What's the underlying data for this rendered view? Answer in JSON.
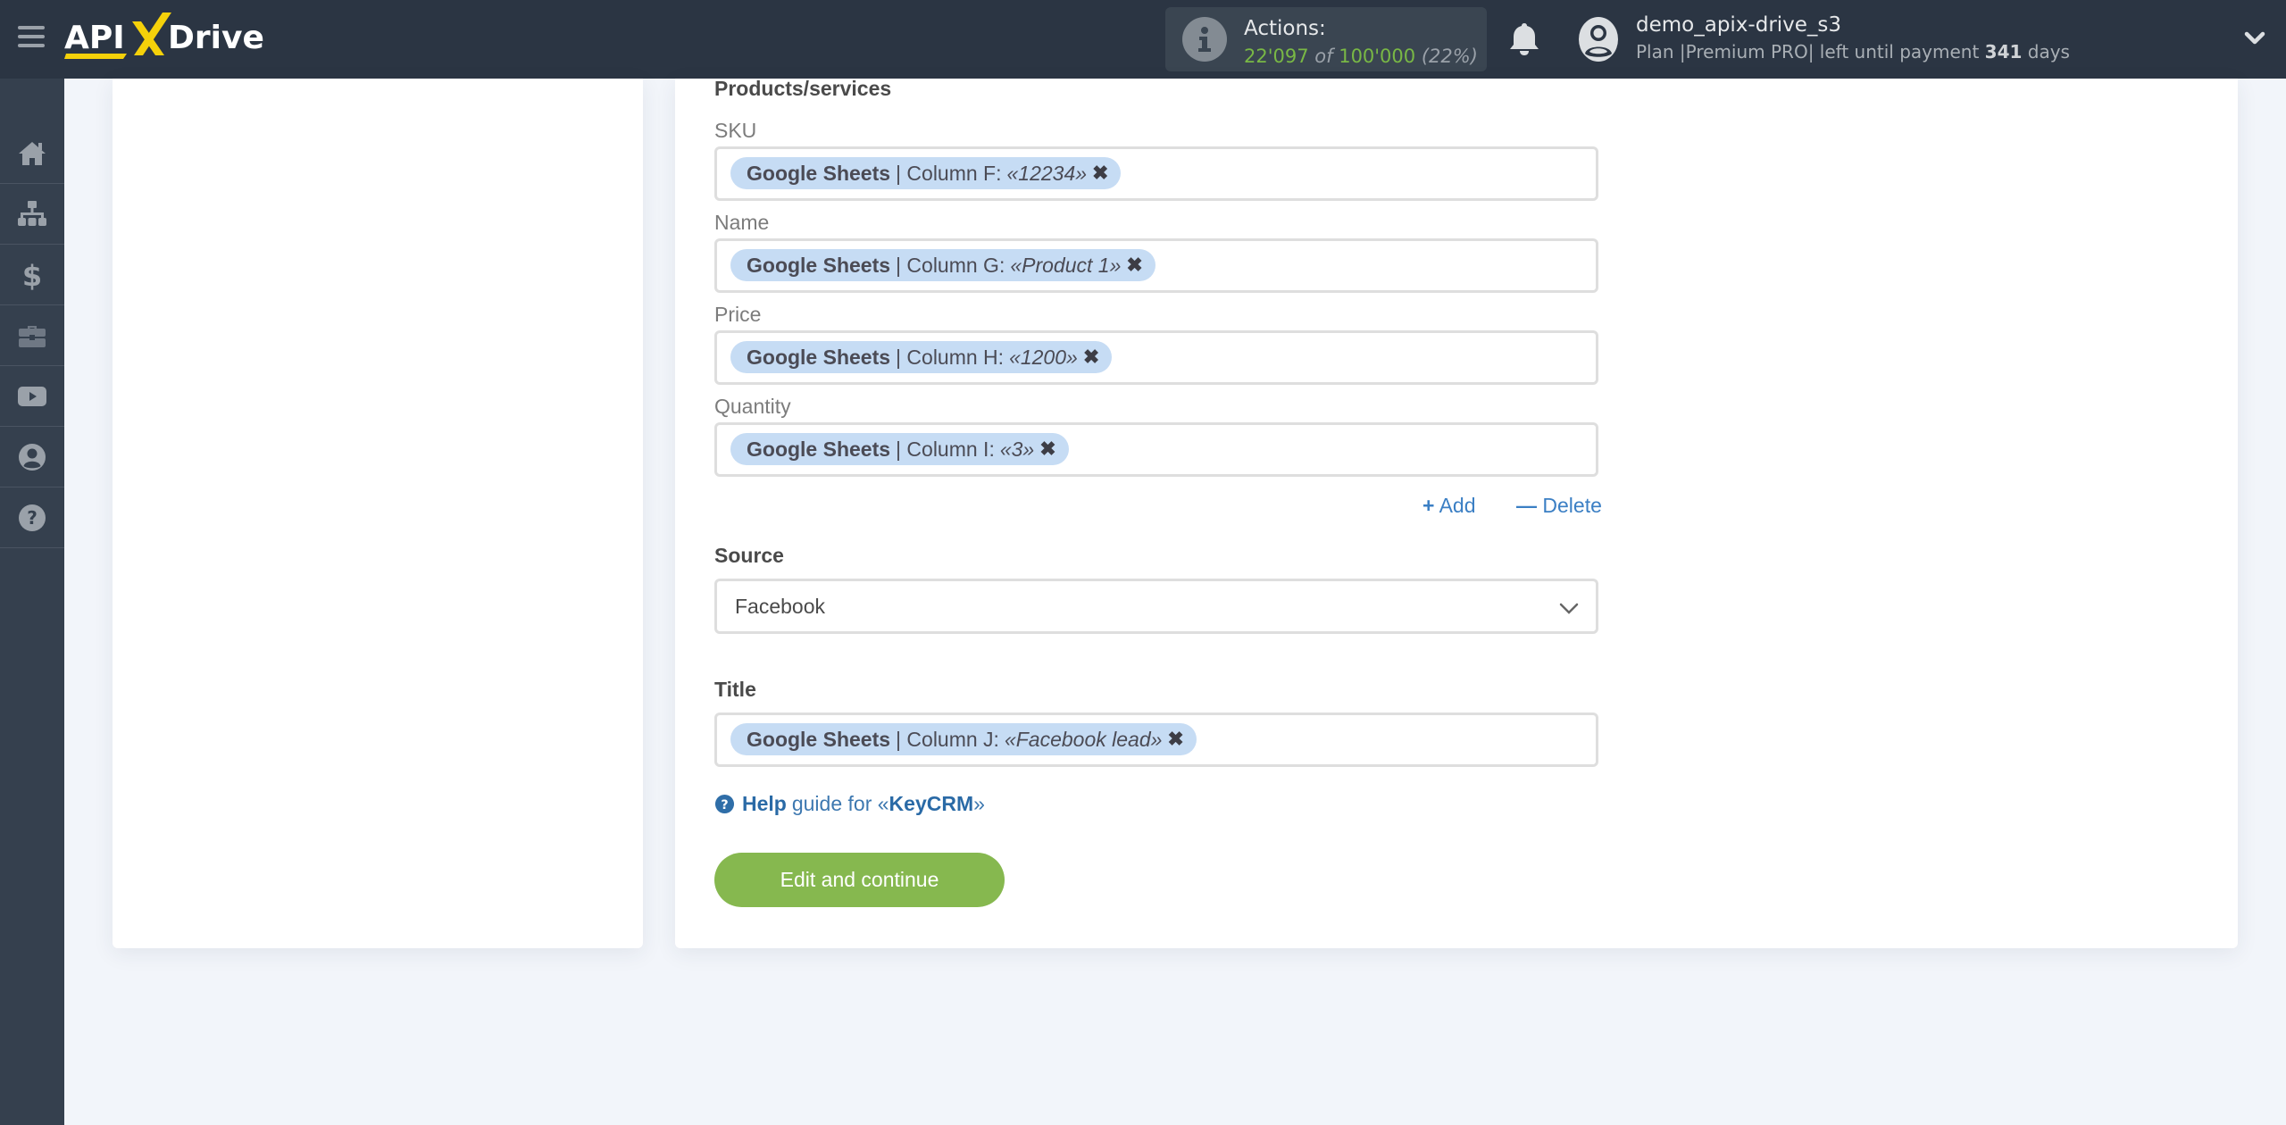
{
  "header": {
    "logo": {
      "part1": "API",
      "part2": "X",
      "part3": "Drive"
    },
    "actions": {
      "label": "Actions:",
      "used": "22'097",
      "of": "of",
      "total": "100'000",
      "percent": "(22%)",
      "usage_fraction": 0.22
    },
    "user": {
      "name": "demo_apix-drive_s3",
      "plan_prefix": "Plan |Premium PRO| left until payment",
      "days_left": "341",
      "days_suffix": "days"
    }
  },
  "sidebar": {
    "items": [
      {
        "name": "home",
        "icon": "home-icon"
      },
      {
        "name": "connections",
        "icon": "sitemap-icon"
      },
      {
        "name": "billing",
        "icon": "dollar-icon"
      },
      {
        "name": "services",
        "icon": "briefcase-icon"
      },
      {
        "name": "video",
        "icon": "youtube-icon"
      },
      {
        "name": "account",
        "icon": "user-circle-icon"
      },
      {
        "name": "help",
        "icon": "question-circle-icon"
      }
    ]
  },
  "form": {
    "section_title": "Products/services",
    "fields": [
      {
        "label": "SKU",
        "chip": {
          "source": "Google Sheets",
          "column": "| Column F:",
          "value": "«12234»"
        }
      },
      {
        "label": "Name",
        "chip": {
          "source": "Google Sheets",
          "column": "| Column G:",
          "value": "«Product 1»"
        }
      },
      {
        "label": "Price",
        "chip": {
          "source": "Google Sheets",
          "column": "| Column H:",
          "value": "«1200»"
        }
      },
      {
        "label": "Quantity",
        "chip": {
          "source": "Google Sheets",
          "column": "| Column I:",
          "value": "«3»"
        }
      }
    ],
    "add_label": "Add",
    "delete_label": "Delete",
    "source": {
      "label": "Source",
      "selected": "Facebook"
    },
    "title": {
      "label": "Title",
      "chip": {
        "source": "Google Sheets",
        "column": "| Column J:",
        "value": "«Facebook lead»"
      }
    },
    "help": {
      "help_word": "Help",
      "guide_text": "guide for «",
      "service": "KeyCRM",
      "closing": "»"
    },
    "submit_label": "Edit and continue"
  },
  "colors": {
    "topbar": "#2b3543",
    "sidebar": "#35404e",
    "accent_green": "#86b84f",
    "chip_bg": "#c6dcf4",
    "link_blue": "#3b7fc4",
    "logo_yellow": "#f5d10a"
  }
}
